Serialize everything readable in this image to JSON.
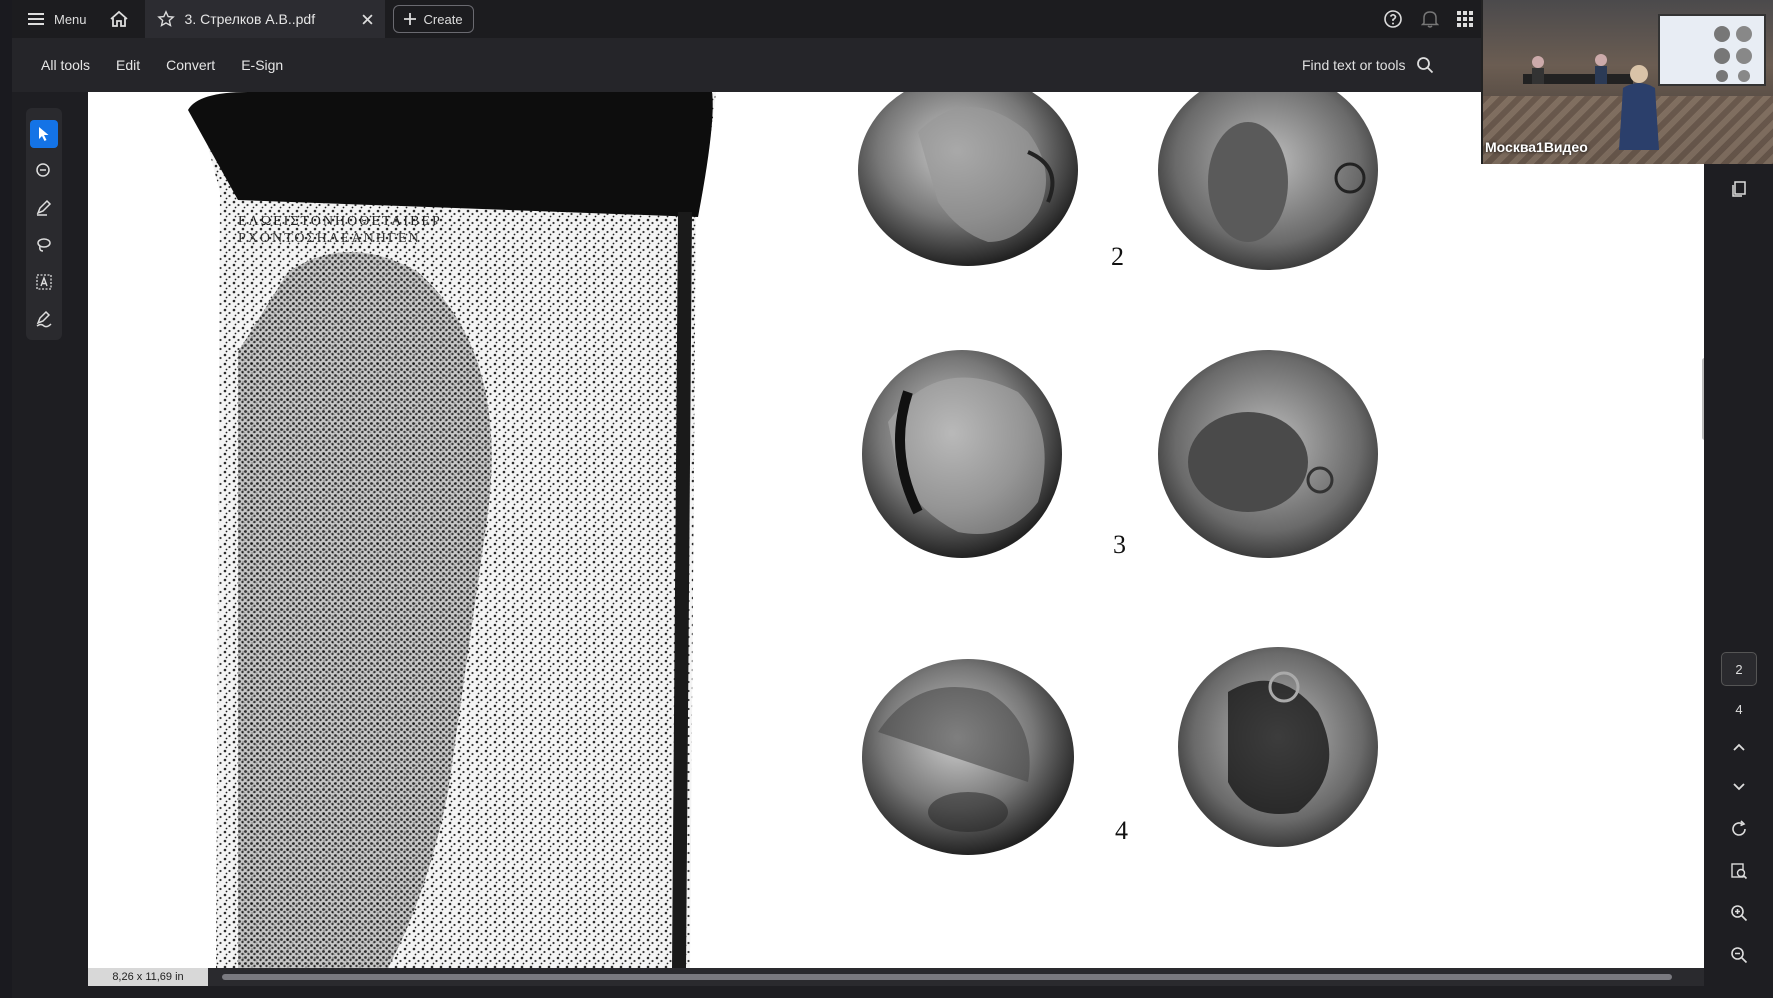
{
  "titlebar": {
    "menu_label": "Menu",
    "tab_title": "3. Стрелков А.В..pdf",
    "create_label": "Create"
  },
  "toolbar": {
    "items": [
      "All tools",
      "Edit",
      "Convert",
      "E-Sign"
    ],
    "find_label": "Find text or tools"
  },
  "document": {
    "figure_numbers": [
      "2",
      "3",
      "4"
    ]
  },
  "status": {
    "page_size": "8,26 x 11,69 in"
  },
  "page_nav": {
    "current": "2",
    "next": "4"
  },
  "video": {
    "label": "Москва1Видео"
  },
  "colors": {
    "accent": "#1473e6",
    "background": "#1e1e22",
    "page": "#ffffff"
  }
}
